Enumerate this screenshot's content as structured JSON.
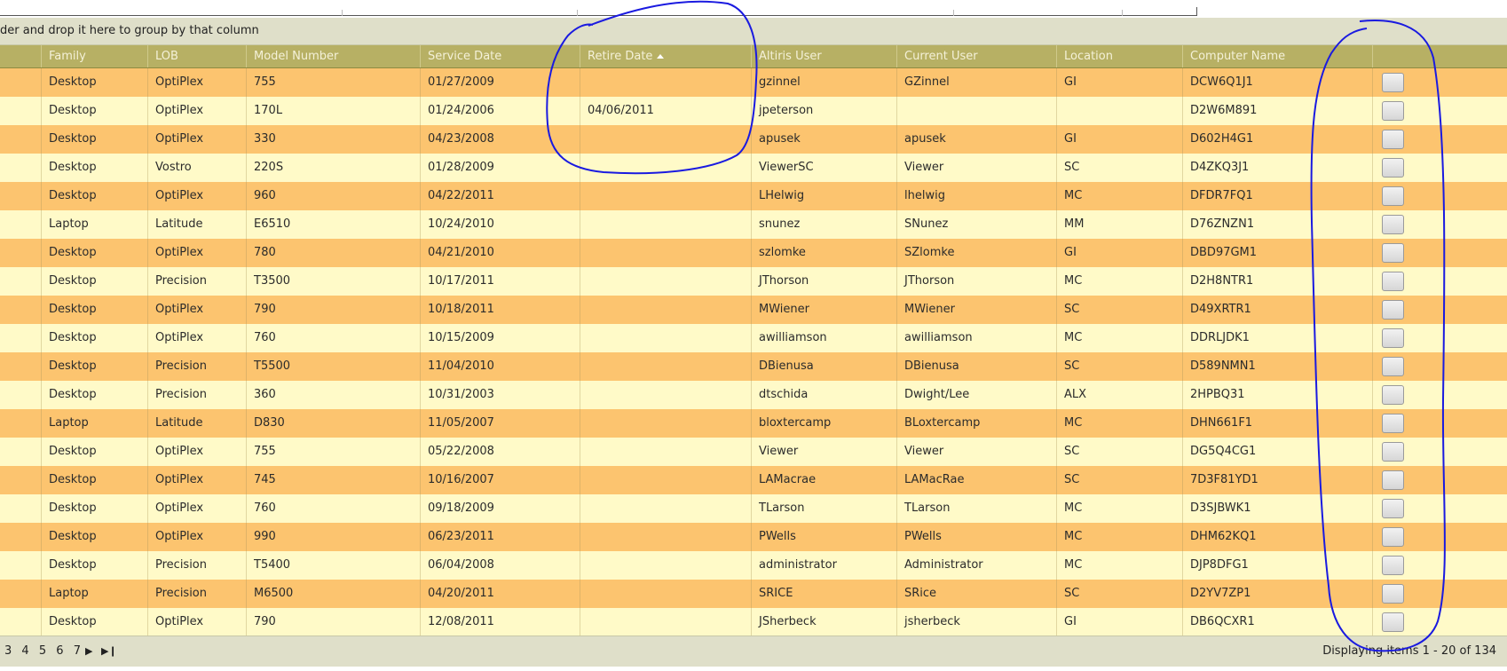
{
  "group_panel": {
    "hint": "der and drop it here to group by that column"
  },
  "columns": [
    "Family",
    "LOB",
    "Model Number",
    "Service Date",
    "Retire Date",
    "Altiris User",
    "Current User",
    "Location",
    "Computer Name"
  ],
  "sort": {
    "column": "Retire Date",
    "direction": "ascending"
  },
  "rows": [
    [
      "Desktop",
      "OptiPlex",
      "755",
      "01/27/2009",
      "",
      "gzinnel",
      "GZinnel",
      "GI",
      "DCW6Q1J1"
    ],
    [
      "Desktop",
      "OptiPlex",
      "170L",
      "01/24/2006",
      "04/06/2011",
      "jpeterson",
      "",
      "",
      "D2W6M891"
    ],
    [
      "Desktop",
      "OptiPlex",
      "330",
      "04/23/2008",
      "",
      "apusek",
      "apusek",
      "GI",
      "D602H4G1"
    ],
    [
      "Desktop",
      "Vostro",
      "220S",
      "01/28/2009",
      "",
      "ViewerSC",
      "Viewer",
      "SC",
      "D4ZKQ3J1"
    ],
    [
      "Desktop",
      "OptiPlex",
      "960",
      "04/22/2011",
      "",
      "LHelwig",
      "lhelwig",
      "MC",
      "DFDR7FQ1"
    ],
    [
      "Laptop",
      "Latitude",
      "E6510",
      "10/24/2010",
      "",
      "snunez",
      "SNunez",
      "MM",
      "D76ZNZN1"
    ],
    [
      "Desktop",
      "OptiPlex",
      "780",
      "04/21/2010",
      "",
      "szlomke",
      "SZlomke",
      "GI",
      "DBD97GM1"
    ],
    [
      "Desktop",
      "Precision",
      "T3500",
      "10/17/2011",
      "",
      "JThorson",
      "JThorson",
      "MC",
      "D2H8NTR1"
    ],
    [
      "Desktop",
      "OptiPlex",
      "790",
      "10/18/2011",
      "",
      "MWiener",
      "MWiener",
      "SC",
      "D49XRTR1"
    ],
    [
      "Desktop",
      "OptiPlex",
      "760",
      "10/15/2009",
      "",
      "awilliamson",
      "awilliamson",
      "MC",
      "DDRLJDK1"
    ],
    [
      "Desktop",
      "Precision",
      "T5500",
      "11/04/2010",
      "",
      "DBienusa",
      "DBienusa",
      "SC",
      "D589NMN1"
    ],
    [
      "Desktop",
      "Precision",
      "360",
      "10/31/2003",
      "",
      "dtschida",
      "Dwight/Lee",
      "ALX",
      "2HPBQ31"
    ],
    [
      "Laptop",
      "Latitude",
      "D830",
      "11/05/2007",
      "",
      "bloxtercamp",
      "BLoxtercamp",
      "MC",
      "DHN661F1"
    ],
    [
      "Desktop",
      "OptiPlex",
      "755",
      "05/22/2008",
      "",
      "Viewer",
      "Viewer",
      "SC",
      "DG5Q4CG1"
    ],
    [
      "Desktop",
      "OptiPlex",
      "745",
      "10/16/2007",
      "",
      "LAMacrae",
      "LAMacRae",
      "SC",
      "7D3F81YD1"
    ],
    [
      "Desktop",
      "OptiPlex",
      "760",
      "09/18/2009",
      "",
      "TLarson",
      "TLarson",
      "MC",
      "D3SJBWK1"
    ],
    [
      "Desktop",
      "OptiPlex",
      "990",
      "06/23/2011",
      "",
      "PWells",
      "PWells",
      "MC",
      "DHM62KQ1"
    ],
    [
      "Desktop",
      "Precision",
      "T5400",
      "06/04/2008",
      "",
      "administrator",
      "Administrator",
      "MC",
      "DJP8DFG1"
    ],
    [
      "Laptop",
      "Precision",
      "M6500",
      "04/20/2011",
      "",
      "SRICE",
      "SRice",
      "SC",
      "D2YV7ZP1"
    ],
    [
      "Desktop",
      "OptiPlex",
      "790",
      "12/08/2011",
      "",
      "JSherbeck",
      "jsherbeck",
      "GI",
      "DB6QCXR1"
    ]
  ],
  "pager": {
    "pages": [
      "3",
      "4",
      "5",
      "6",
      "7"
    ],
    "next_icon": "next-page-icon",
    "last_icon": "last-page-icon",
    "info": "Displaying items 1 - 20 of 134"
  },
  "colors": {
    "header_bg": "#b7b064",
    "row_odd": "#fcc46f",
    "row_even": "#fffac8",
    "panel_bg": "#dfdfc9",
    "annotation_stroke": "#1a1ae0"
  }
}
